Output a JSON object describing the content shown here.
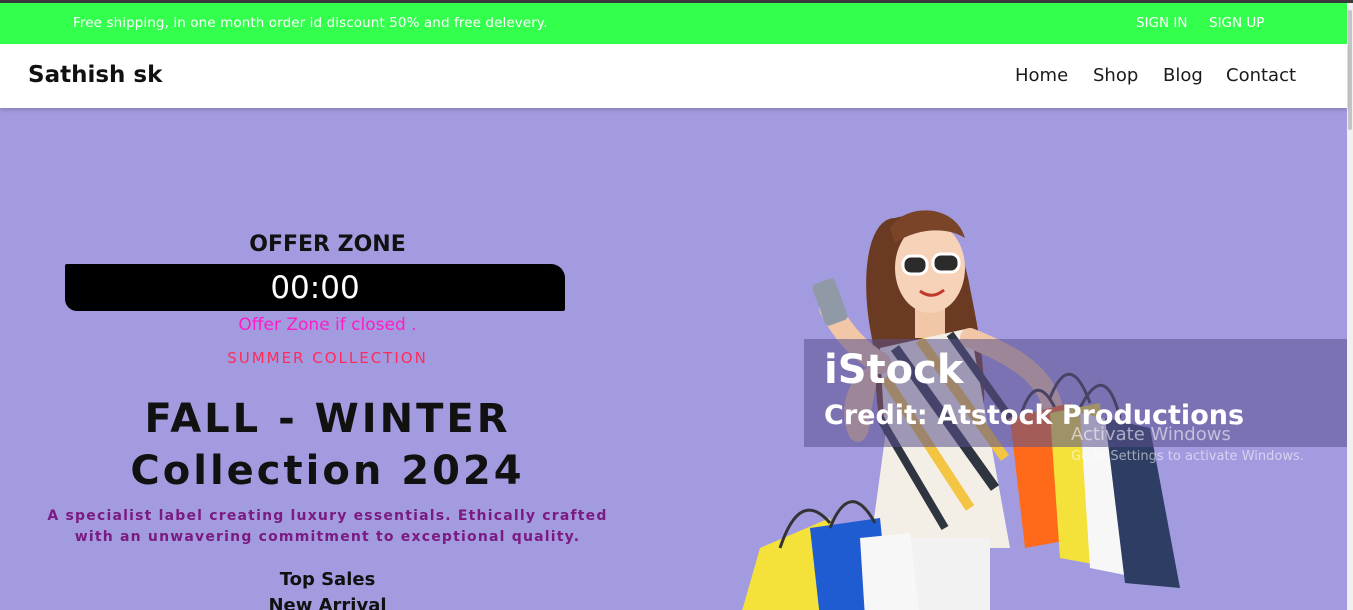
{
  "promo": {
    "text": "Free shipping, in one month order id discount 50% and free delevery.",
    "sign_in": "SIGN IN",
    "sign_up": "SIGN UP"
  },
  "nav": {
    "brand": "Sathish sk",
    "links": [
      "Home",
      "Shop",
      "Blog",
      "Contact"
    ]
  },
  "hero": {
    "offer_title": "OFFER ZONE",
    "timer": "00:00",
    "offer_status": "Offer Zone if closed .",
    "eyebrow": "SUMMER COLLECTION",
    "headline_line1": "FALL - WINTER",
    "headline_line2": "Collection 2024",
    "tagline_line1": "A specialist label creating luxury essentials. Ethically crafted",
    "tagline_line2": "with an unwavering commitment to exceptional quality.",
    "menu": [
      "Top Sales",
      "New Arrival"
    ]
  },
  "image_watermark": {
    "brand": "iStock",
    "credit": "Credit: Atstock Productions"
  },
  "os_overlay": {
    "title": "Activate Windows",
    "subtitle": "Go to Settings to activate Windows."
  },
  "colors": {
    "promo_bar": "#33ff4d",
    "hero_bg": "#a39be0",
    "offer_status": "#ff1ac6",
    "eyebrow": "#ff2a5a",
    "tagline": "#7a1a82"
  }
}
